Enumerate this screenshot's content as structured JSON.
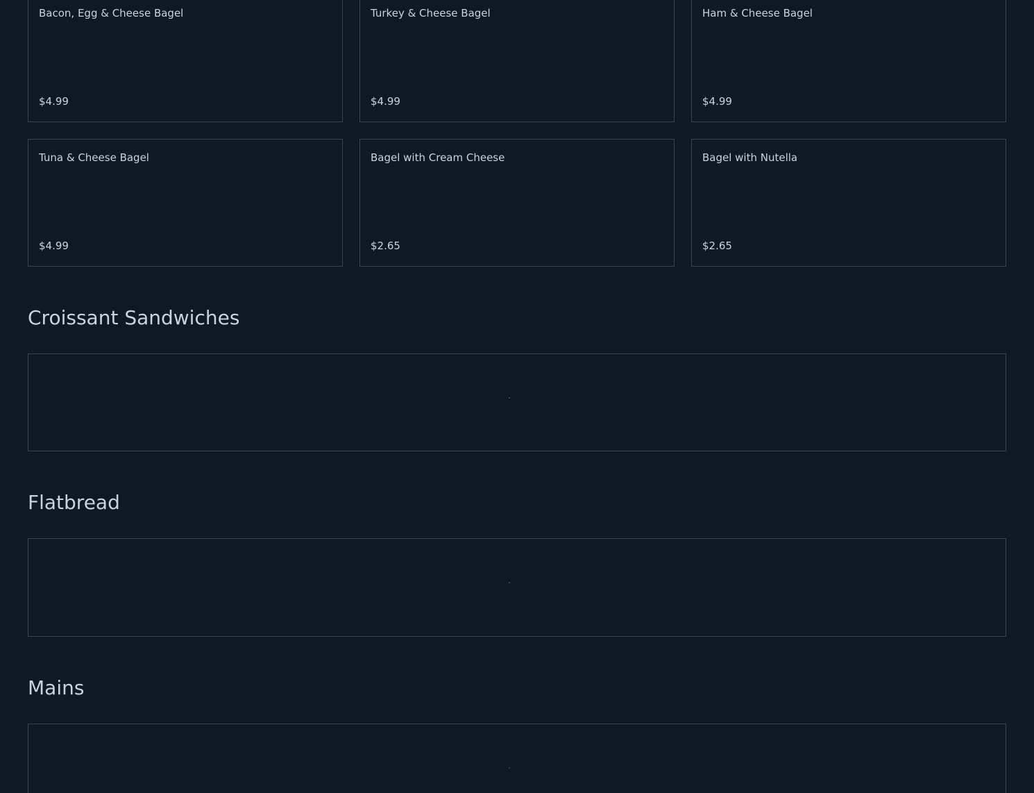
{
  "colors": {
    "background": "#0f1923",
    "text": "#c9d3dc",
    "border": "#3a444d"
  },
  "bagel_items": [
    {
      "name": "Bacon, Egg & Cheese Bagel",
      "price": "$4.99"
    },
    {
      "name": "Turkey & Cheese Bagel",
      "price": "$4.99"
    },
    {
      "name": "Ham & Cheese Bagel",
      "price": "$4.99"
    },
    {
      "name": "Tuna & Cheese Bagel",
      "price": "$4.99"
    },
    {
      "name": "Bagel with Cream Cheese",
      "price": "$2.65"
    },
    {
      "name": "Bagel with Nutella",
      "price": "$2.65"
    }
  ],
  "sections": {
    "croissant": {
      "title": "Croissant Sandwiches"
    },
    "flatbread": {
      "title": "Flatbread"
    },
    "mains": {
      "title": "Mains"
    }
  }
}
